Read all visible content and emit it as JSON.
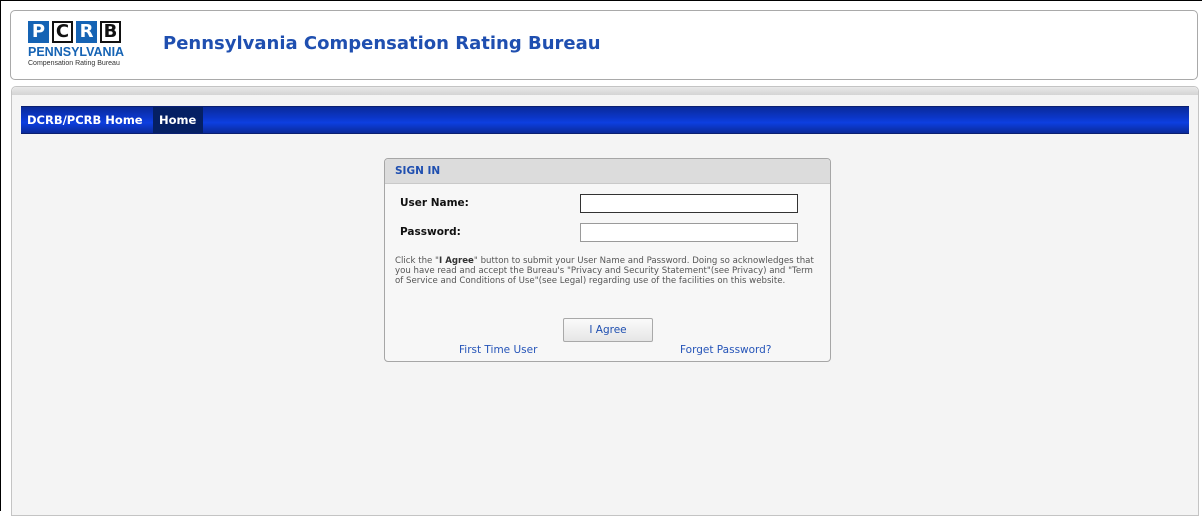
{
  "logo": {
    "letters": [
      "P",
      "C",
      "R",
      "B"
    ],
    "state": "PENNSYLVANIA",
    "subtitle": "Compensation Rating Bureau"
  },
  "header": {
    "title": "Pennsylvania Compensation Rating Bureau"
  },
  "nav": {
    "items": [
      "DCRB/PCRB Home",
      "Home"
    ]
  },
  "signin": {
    "heading": "SIGN IN",
    "username_label": "User Name:",
    "username_value": "",
    "password_label": "Password:",
    "password_value": "",
    "notice_prefix": "Click the \"",
    "notice_bold": "I Agree",
    "notice_rest": "\" button to submit your User Name and Password. Doing so acknowledges that you have read and accept the Bureau's \"Privacy and Security Statement\"(see Privacy) and \"Term of Service and Conditions of Use\"(see Legal) regarding use of the facilities on this website.",
    "agree_label": "I Agree",
    "first_time_link": "First Time User",
    "forgot_link": "Forget Password?"
  },
  "colors": {
    "brand_blue": "#1563b4",
    "title_blue": "#1f4fb0",
    "nav_blue": "#0b36c8"
  }
}
